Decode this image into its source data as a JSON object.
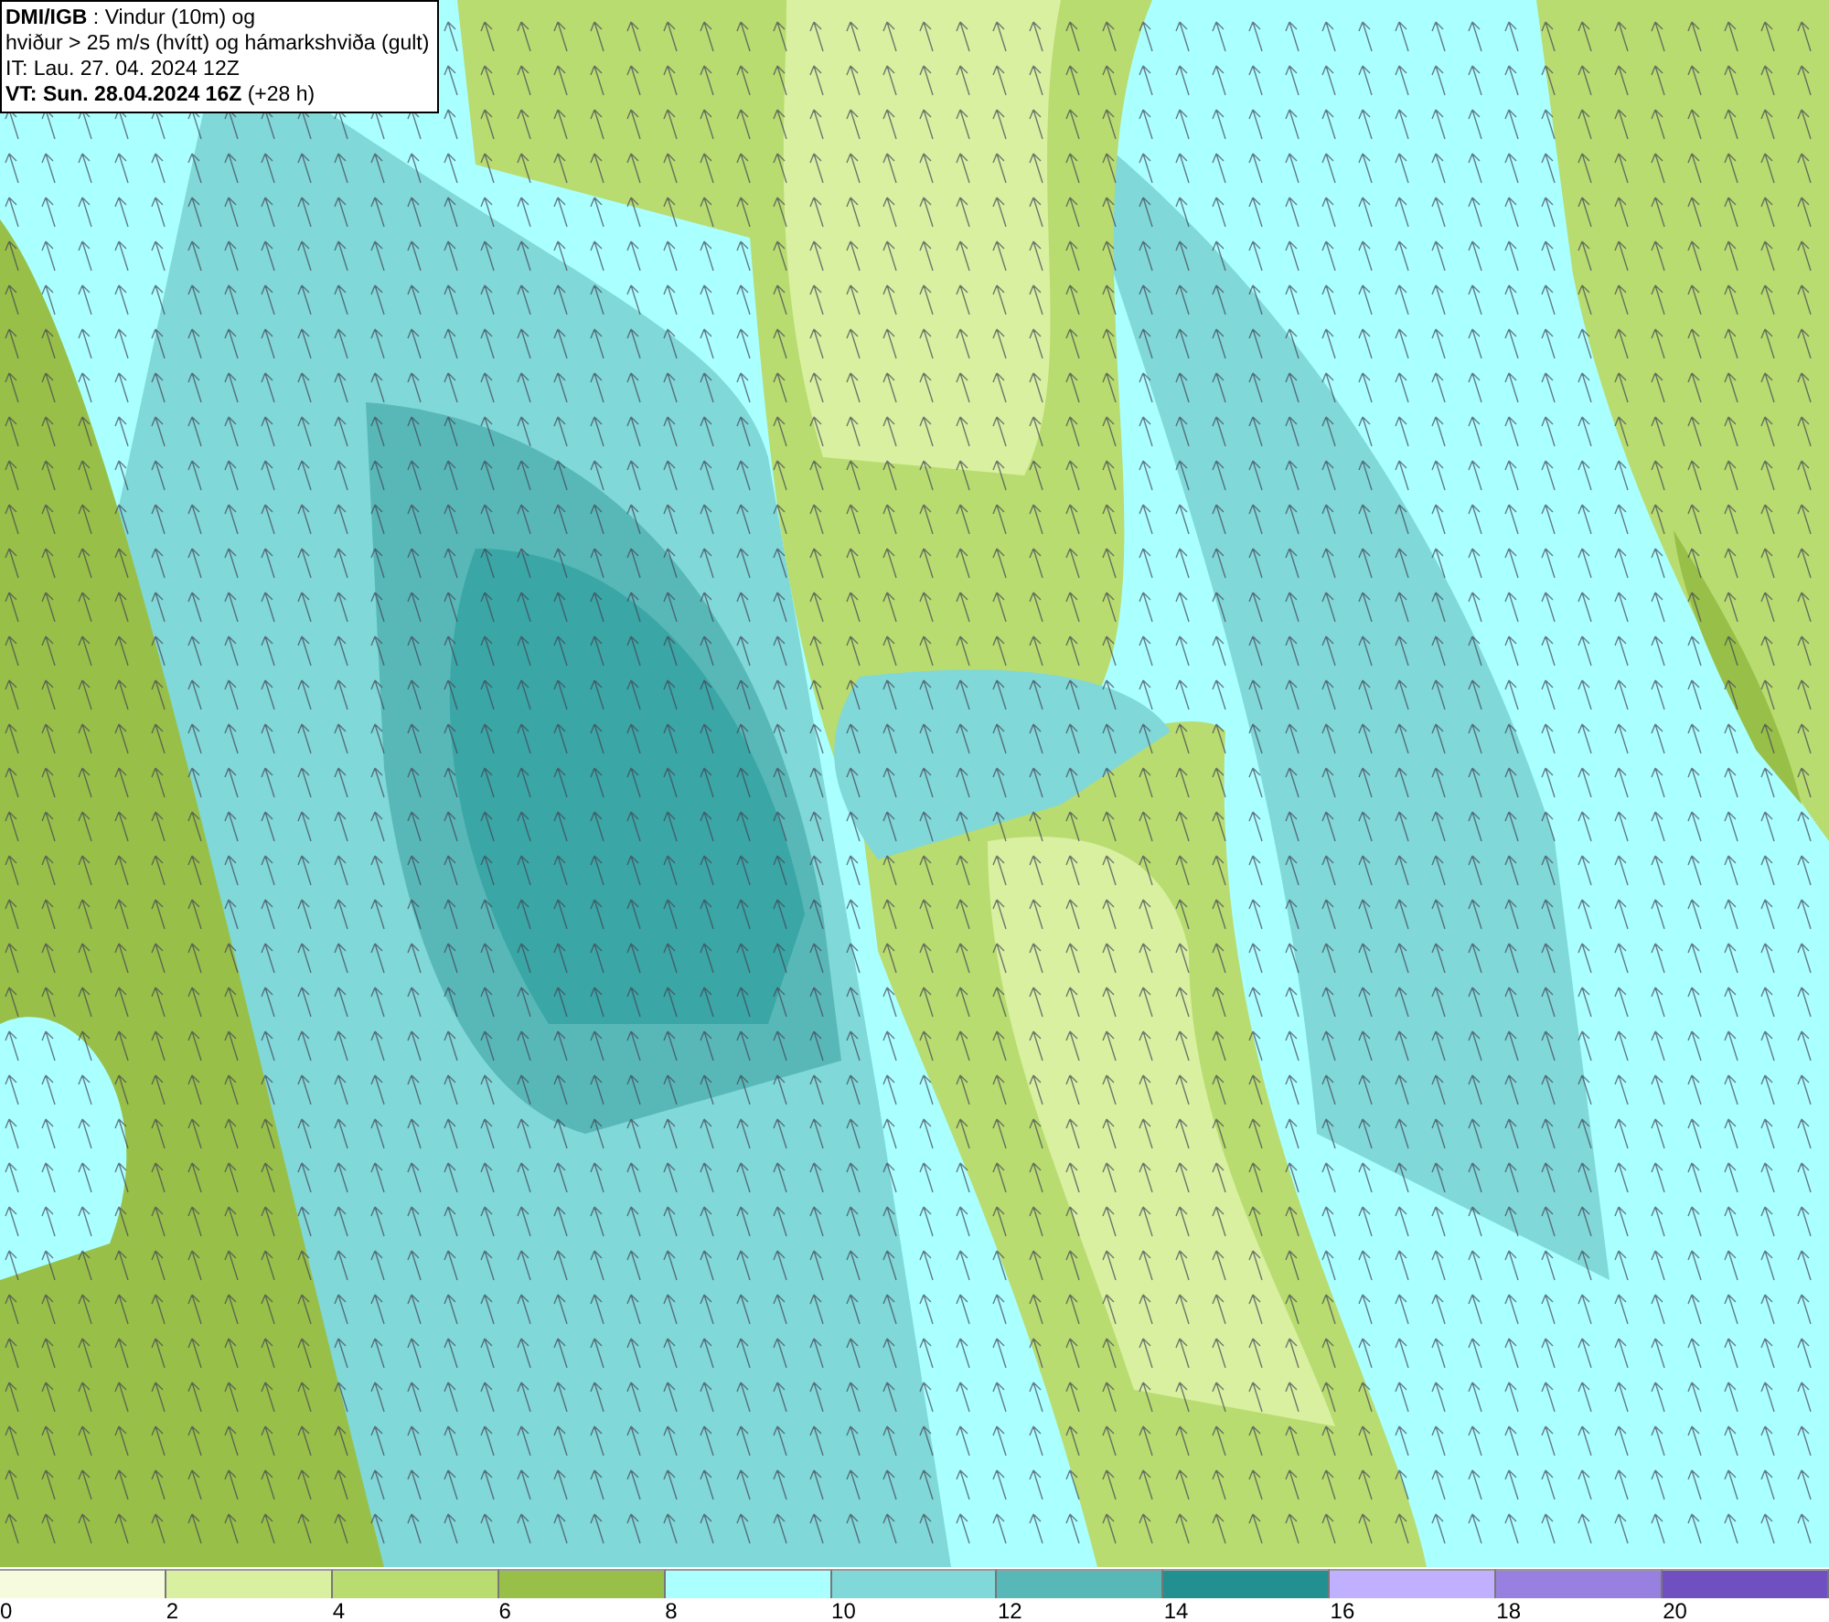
{
  "header": {
    "lines": [
      "**DMI/IGB** : Vindur (10m) og",
      "hviður > 25 m/s (hvítt) og hámarkshviða (gult)",
      "IT: Lau. 27. 04. 2024 12Z",
      "**VT: Sun. 28.04.2024 16Z** (+28 h)"
    ]
  },
  "legend": [
    {
      "label": "0",
      "color": "#f5fbdc"
    },
    {
      "label": "2",
      "color": "#d8f0a0"
    },
    {
      "label": "4",
      "color": "#b8dc70"
    },
    {
      "label": "6",
      "color": "#98c048"
    },
    {
      "label": "8",
      "color": "#aaffff"
    },
    {
      "label": "10",
      "color": "#80d8d8"
    },
    {
      "label": "12",
      "color": "#58b8b8"
    },
    {
      "label": "14",
      "color": "#229090"
    },
    {
      "label": "16",
      "color": "#c0b0ff"
    },
    {
      "label": "18",
      "color": "#9880e0"
    },
    {
      "label": "20",
      "color": "#7050c0"
    }
  ]
}
